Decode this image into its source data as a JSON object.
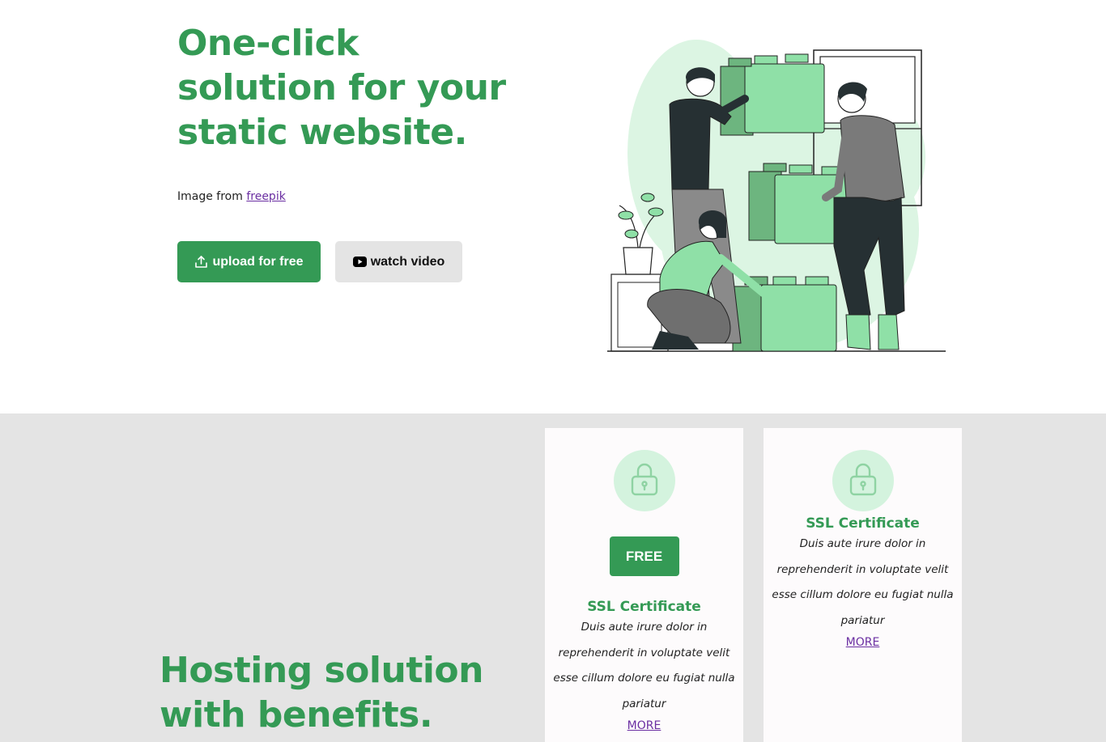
{
  "hero": {
    "title": "One-click solution for your static website.",
    "credit_prefix": "Image from ",
    "credit_link": "freepik",
    "upload_button": "upload for free",
    "watch_button": "watch video",
    "upload_icon": "upload-icon",
    "watch_icon": "youtube-play-icon"
  },
  "benefits": {
    "title": "Hosting solution with benefits.",
    "cards": [
      {
        "icon": "lock-icon",
        "badge": "FREE",
        "title": "SSL Certificate",
        "text": "Duis aute irure dolor in reprehenderit in voluptate velit esse cillum dolore eu fugiat nulla pariatur",
        "link": "MORE"
      },
      {
        "icon": "lock-icon",
        "title": "SSL Certificate",
        "text": "Duis aute irure dolor in reprehenderit in voluptate velit esse cillum dolore eu fugiat nulla pariatur",
        "link": "MORE"
      }
    ]
  },
  "colors": {
    "brand_green": "#349a55",
    "light_green": "#d4f3de",
    "section_gray": "#e4e4e4",
    "link_purple": "#6b2fa2"
  }
}
